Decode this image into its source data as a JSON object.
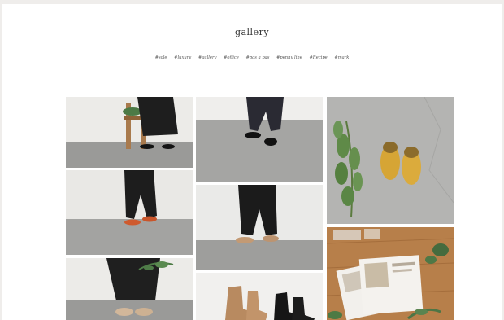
{
  "gallery": {
    "title": "gallery",
    "tags": [
      "#sole",
      "#luxury",
      "#gallery",
      "#office",
      "#pas a pas",
      "#penny line",
      "#Recipe",
      "#mark"
    ]
  },
  "colors": {
    "background": "#efedeb",
    "page": "#ffffff",
    "wall": "#ecebe8",
    "floor": "#9c9c9a",
    "mustard": "#d8a93a",
    "terracotta": "#cf5a2e",
    "tan": "#c39a74",
    "wood": "#b77f4a"
  },
  "photos": [
    {
      "name": "photo-black-trousers-stool",
      "alt": "black trousers and black flats beside wooden stool"
    },
    {
      "name": "photo-black-loafers",
      "alt": "black loafers on grey floor"
    },
    {
      "name": "photo-mustard-sandals",
      "alt": "mustard sandals with green branch"
    },
    {
      "name": "photo-orange-flats",
      "alt": "orange flats with black trousers"
    },
    {
      "name": "photo-tan-slides",
      "alt": "tan slides with black trousers"
    },
    {
      "name": "photo-wood-table-prints",
      "alt": "prints on wooden table"
    },
    {
      "name": "photo-beige-shoes-plant",
      "alt": "beige shoes with plant"
    },
    {
      "name": "photo-ankle-boots",
      "alt": "tan and black ankle boots"
    }
  ]
}
